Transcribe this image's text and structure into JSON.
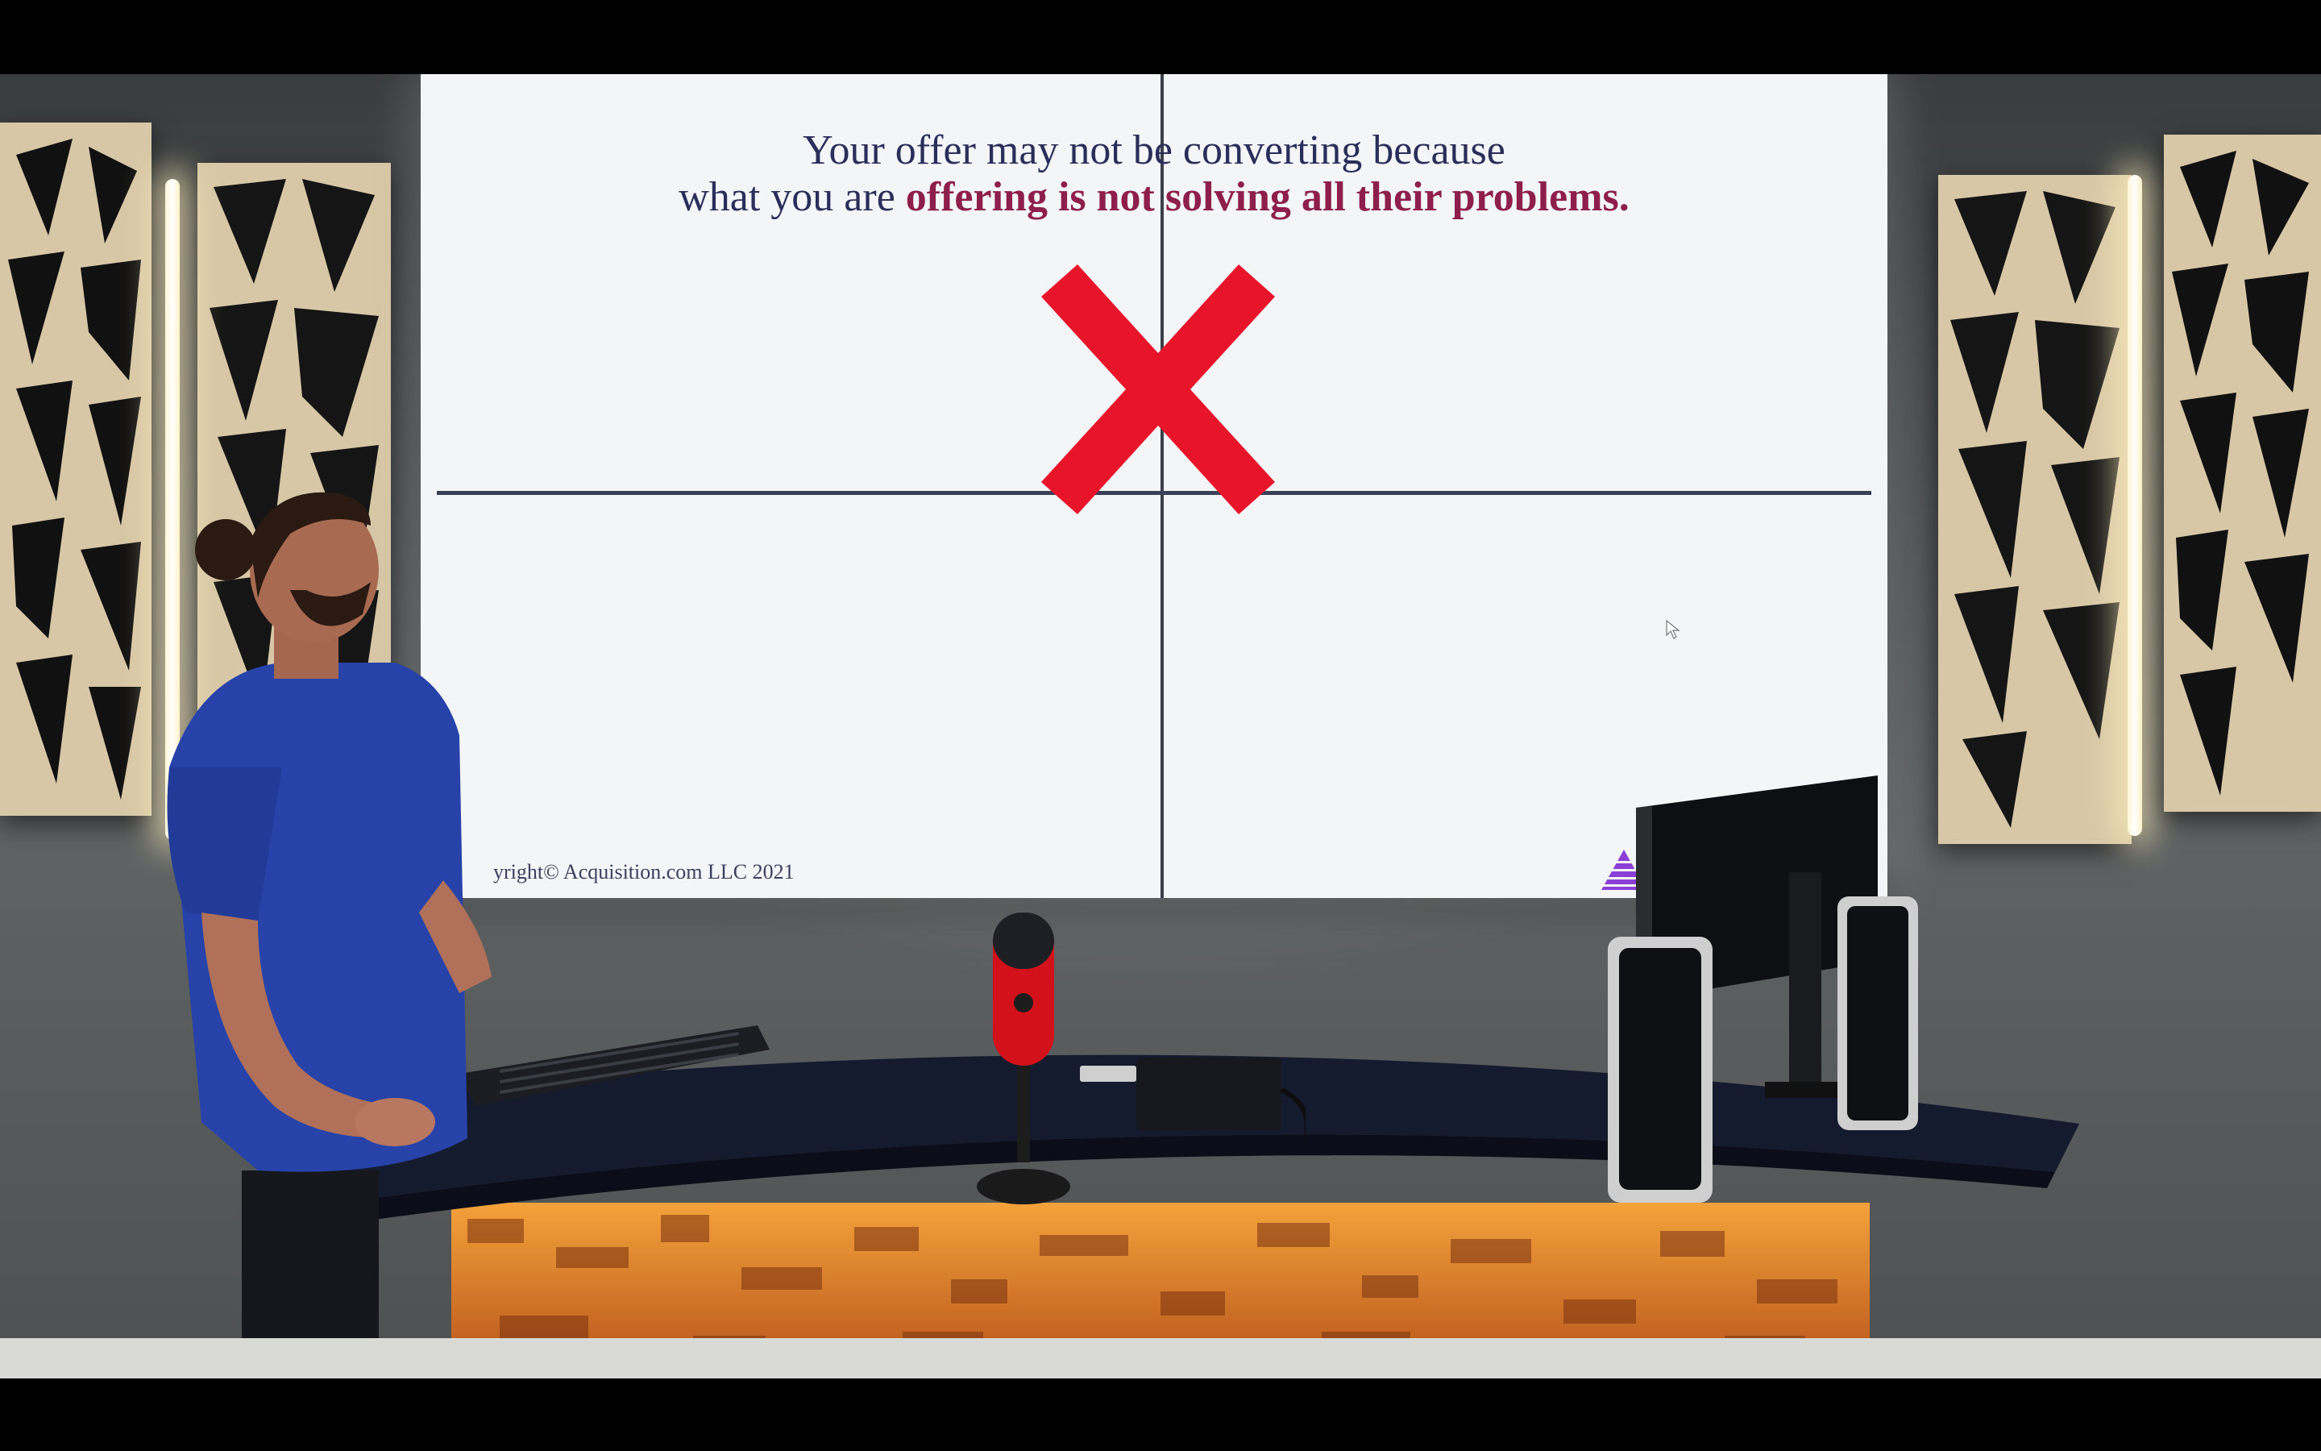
{
  "slide": {
    "title_line1": "Your offer may not be converting because",
    "title_line2_plain": "what you are ",
    "title_line2_emphasis": "offering is not solving all their problems.",
    "copyright": "yright© Acquisition.com LLC 2021"
  },
  "icons": {
    "red_x": "red-x-icon",
    "logo": "pyramid-logo-icon",
    "cursor": "mouse-cursor-icon"
  },
  "colors": {
    "title_text": "#2a2e5a",
    "emphasis_text": "#8e1f4c",
    "red_x": "#e8152a",
    "logo": "#8b3fd6"
  }
}
